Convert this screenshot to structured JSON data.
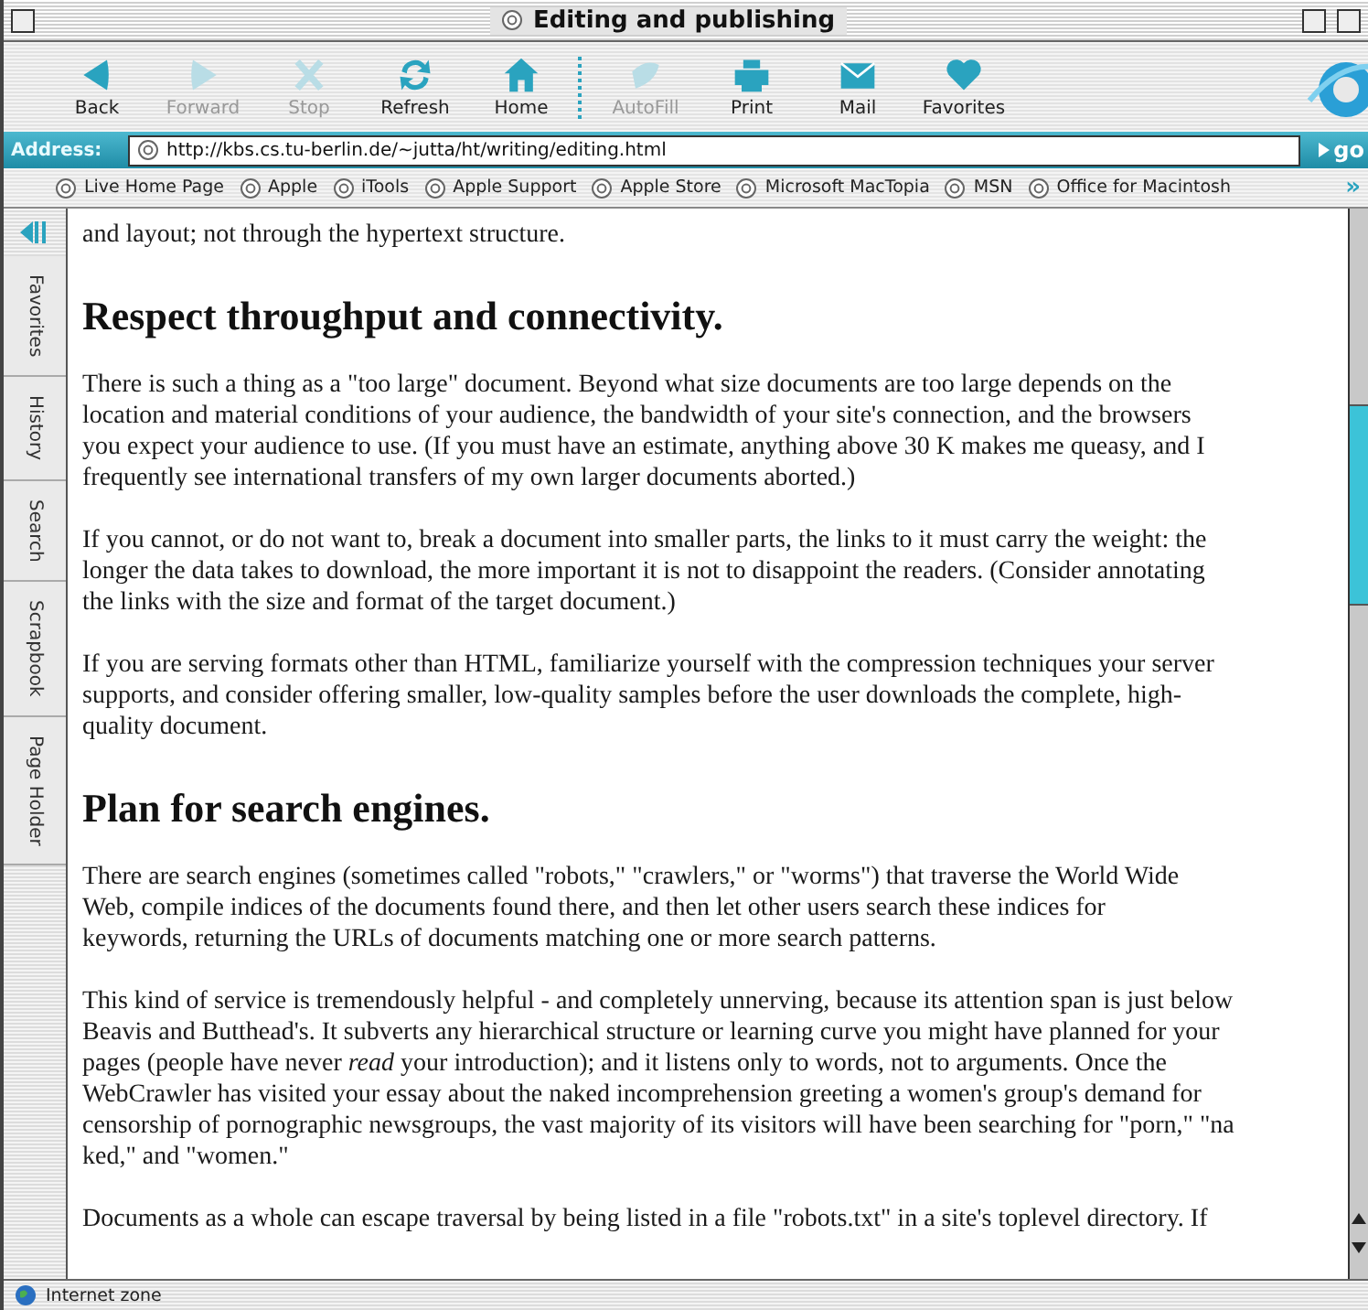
{
  "window": {
    "title": "Editing and publishing"
  },
  "toolbar": {
    "groups": [
      [
        {
          "label": "Back",
          "disabled": false
        },
        {
          "label": "Forward",
          "disabled": true
        },
        {
          "label": "Stop",
          "disabled": true
        },
        {
          "label": "Refresh",
          "disabled": false
        },
        {
          "label": "Home",
          "disabled": false
        }
      ],
      [
        {
          "label": "AutoFill",
          "disabled": true
        },
        {
          "label": "Print",
          "disabled": false
        },
        {
          "label": "Mail",
          "disabled": false
        },
        {
          "label": "Favorites",
          "disabled": false
        }
      ]
    ]
  },
  "address": {
    "label": "Address:",
    "value": "http://kbs.cs.tu-berlin.de/~jutta/ht/writing/editing.html",
    "go": "go"
  },
  "favorites_bar": {
    "items": [
      "Live Home Page",
      "Apple",
      "iTools",
      "Apple Support",
      "Apple Store",
      "Microsoft MacTopia",
      "MSN",
      "Office for Macintosh"
    ],
    "more": "»"
  },
  "sidebar_tabs": [
    "Favorites",
    "History",
    "Search",
    "Scrapbook",
    "Page Holder"
  ],
  "page": {
    "blocks": [
      {
        "kind": "paragraph",
        "lines": [
          "and layout; not through the hypertext structure."
        ]
      },
      {
        "kind": "heading",
        "text": "Respect throughput and connectivity."
      },
      {
        "kind": "paragraph",
        "lines": [
          "There is such a thing as a \"too large\" document. Beyond what size documents are too large depends on the",
          "location and material conditions of your audience, the bandwidth of your site's connection, and the browsers",
          "you expect your audience to use. (If you must have an estimate, anything above 30 K makes me queasy, and I",
          "frequently see international transfers of my own larger documents aborted.)"
        ]
      },
      {
        "kind": "paragraph",
        "lines": [
          "If you cannot, or do not want to, break a document into smaller parts, the links to it must carry the weight: the",
          "longer the data takes to download, the more important it is not to disappoint the readers. (Consider annotating",
          "the links with the size and format of the target document.)"
        ]
      },
      {
        "kind": "paragraph",
        "lines": [
          "If you are serving formats other than HTML, familiarize yourself with the compression techniques your server",
          "supports, and consider offering smaller, low-quality samples before the user downloads the complete, high-",
          "quality document."
        ]
      },
      {
        "kind": "heading",
        "text": "Plan for search engines."
      },
      {
        "kind": "paragraph",
        "lines": [
          "There are search engines (sometimes called \"robots,\" \"crawlers,\" or \"worms\") that traverse the World Wide",
          "Web, compile indices of the documents found there, and then let other users search these indices for",
          "keywords, returning the URLs of documents matching one or more search patterns."
        ]
      },
      {
        "kind": "paragraph",
        "lines": [
          "This kind of service is tremendously helpful - and completely unnerving, because its attention span is just below",
          "Beavis and Butthead's. It subverts any hierarchical structure or learning curve you might have planned for your",
          "pages (people have never *read* your introduction); and it listens only to words, not to arguments. Once the",
          "WebCrawler has visited your essay about the naked incomprehension greeting a women's group's demand for",
          "censorship of pornographic newsgroups, the vast majority of its visitors will have been searching for \"porn,\" \"na",
          "ked,\" and \"women.\""
        ]
      },
      {
        "kind": "paragraph",
        "lines": [
          "Documents as a whole can escape traversal by being listed in a file \"robots.txt\" in a site's toplevel directory. If"
        ]
      }
    ]
  },
  "status_bar": {
    "zone": "Internet zone"
  }
}
